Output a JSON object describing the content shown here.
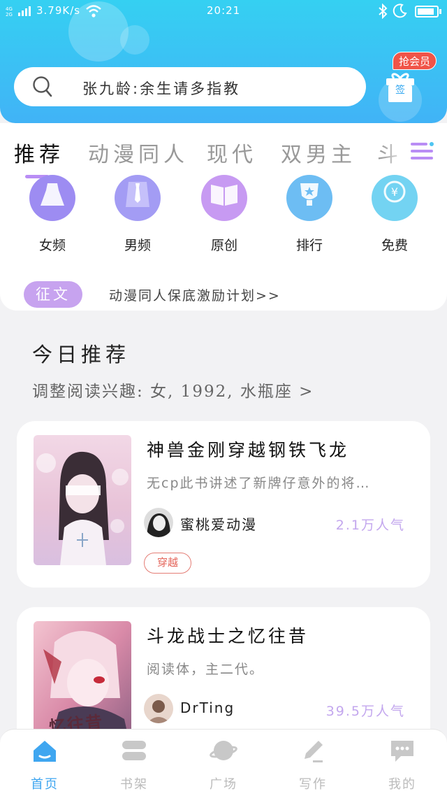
{
  "status_bar": {
    "network": "4G\n2G",
    "speed": "3.79K/s",
    "time": "20:21",
    "battery_level": 0.9
  },
  "search": {
    "placeholder": "张九龄:余生请多指教"
  },
  "vip": {
    "badge": "抢会员",
    "gift_label": "签"
  },
  "tabs": [
    {
      "label": "推荐",
      "active": true
    },
    {
      "label": "动漫同人",
      "active": false
    },
    {
      "label": "现代",
      "active": false
    },
    {
      "label": "双男主",
      "active": false
    },
    {
      "label": "斗",
      "active": false
    }
  ],
  "categories": [
    {
      "label": "女频",
      "icon": "dress-icon",
      "color": "#9d8cf2"
    },
    {
      "label": "男频",
      "icon": "shirt-tie-icon",
      "color": "#a39cf4"
    },
    {
      "label": "原创",
      "icon": "open-book-icon",
      "color": "#c79af2"
    },
    {
      "label": "排行",
      "icon": "trophy-icon",
      "color": "#6dbdf3"
    },
    {
      "label": "免费",
      "icon": "yen-coin-icon",
      "color": "#73d3f2"
    }
  ],
  "notice": {
    "badge": "征文",
    "text": "动漫同人保底激励计划>>"
  },
  "today": {
    "title": "今日推荐",
    "subtitle": "调整阅读兴趣: 女, 1992, 水瓶座 >"
  },
  "books": [
    {
      "title": "神兽金刚穿越钢铁飞龙",
      "desc": "无cp此书讲述了新牌仔意外的将…",
      "author": "蜜桃爱动漫",
      "popularity": "2.1万人气",
      "tag": "穿越"
    },
    {
      "title": "斗龙战士之忆往昔",
      "desc": "阅读体，主二代。",
      "author": "DrTing",
      "popularity": "39.5万人气",
      "cover_text": "忆往昔",
      "tag": ""
    }
  ],
  "nav": [
    {
      "label": "首页",
      "icon": "home-icon",
      "active": true
    },
    {
      "label": "书架",
      "icon": "bookshelf-icon",
      "active": false
    },
    {
      "label": "广场",
      "icon": "planet-icon",
      "active": false
    },
    {
      "label": "写作",
      "icon": "pen-icon",
      "active": false
    },
    {
      "label": "我的",
      "icon": "chat-bubble-icon",
      "active": false
    }
  ],
  "colors": {
    "header_top": "#35d0f2",
    "header_bottom": "#41b3f6",
    "accent_purple": "#b98df5",
    "vip_red": "#f05448",
    "nav_active": "#3fa6f0"
  }
}
